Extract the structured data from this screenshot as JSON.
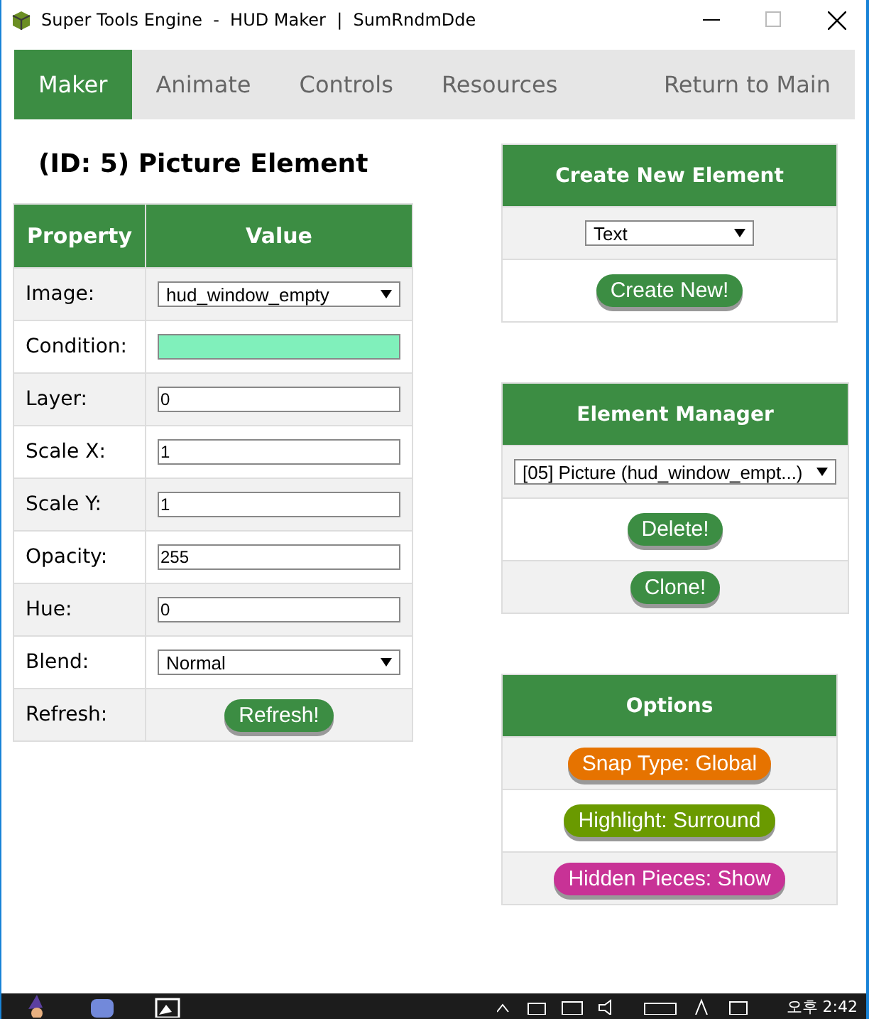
{
  "window": {
    "title": "Super Tools Engine  -  HUD Maker  |  SumRndmDde"
  },
  "nav": {
    "tabs": [
      {
        "label": "Maker",
        "selected": true
      },
      {
        "label": "Animate",
        "selected": false
      },
      {
        "label": "Controls",
        "selected": false
      },
      {
        "label": "Resources",
        "selected": false
      }
    ],
    "return_link": "Return to Main"
  },
  "properties": {
    "title": "(ID: 5) Picture Element",
    "columns": [
      "Property",
      "Value"
    ],
    "rows": [
      {
        "label": "Image:",
        "kind": "select",
        "value": "hud_window_empty"
      },
      {
        "label": "Condition:",
        "kind": "input",
        "value": ""
      },
      {
        "label": "Layer:",
        "kind": "input",
        "value": "0"
      },
      {
        "label": "Scale X:",
        "kind": "input",
        "value": "1"
      },
      {
        "label": "Scale Y:",
        "kind": "input",
        "value": "1"
      },
      {
        "label": "Opacity:",
        "kind": "input",
        "value": "255"
      },
      {
        "label": "Hue:",
        "kind": "input",
        "value": "0"
      },
      {
        "label": "Blend:",
        "kind": "select",
        "value": "Normal"
      },
      {
        "label": "Refresh:",
        "kind": "button",
        "value": "Refresh!"
      }
    ]
  },
  "create_panel": {
    "title": "Create New Element",
    "select_value": "Text",
    "button": "Create New!"
  },
  "manager": {
    "title": "Element Manager",
    "select_value": "[05] Picture (hud_window_empt...)",
    "buttons": [
      "Delete!",
      "Clone!"
    ]
  },
  "options": {
    "title": "Options",
    "buttons": [
      {
        "label": "Snap Type: Global",
        "color": "#e67300"
      },
      {
        "label": "Highlight: Surround",
        "color": "#6a9a00"
      },
      {
        "label": "Hidden Pieces: Show",
        "color": "#c83296"
      }
    ]
  },
  "taskbar": {
    "clock": "오후 2:42"
  }
}
